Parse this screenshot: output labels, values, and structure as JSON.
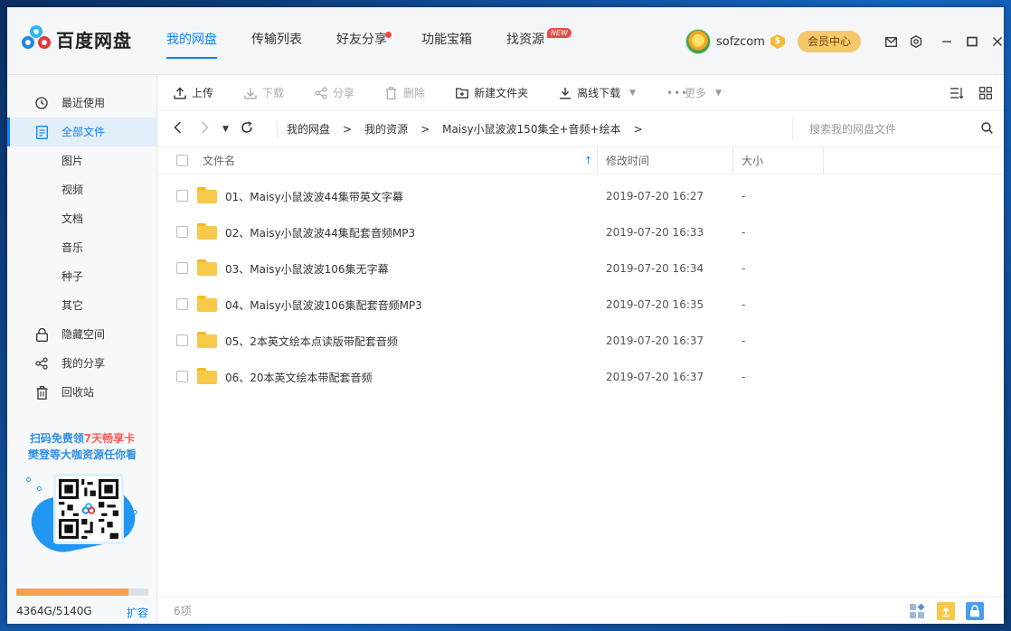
{
  "app": {
    "logo_text": "百度网盘"
  },
  "nav": {
    "tabs": [
      {
        "label": "我的网盘"
      },
      {
        "label": "传输列表"
      },
      {
        "label": "好友分享"
      },
      {
        "label": "功能宝箱"
      },
      {
        "label": "找资源",
        "badge": "NEW"
      }
    ]
  },
  "user": {
    "name": "sofzcom",
    "coin_symbol": "$",
    "member_label": "会员中心"
  },
  "sidebar": {
    "items": [
      {
        "label": "最近使用"
      },
      {
        "label": "全部文件"
      },
      {
        "label": "图片"
      },
      {
        "label": "视频"
      },
      {
        "label": "文档"
      },
      {
        "label": "音乐"
      },
      {
        "label": "种子"
      },
      {
        "label": "其它"
      },
      {
        "label": "隐藏空间"
      },
      {
        "label": "我的分享"
      },
      {
        "label": "回收站"
      }
    ],
    "promo": {
      "line1_a": "扫码免费领",
      "line1_hl": "7天畅享卡",
      "line2": "樊登等大咖资源任你看"
    },
    "storage": {
      "used_text": "4364G/5140G",
      "used_fraction": 0.849,
      "expand_label": "扩容"
    }
  },
  "toolbar": {
    "upload": "上传",
    "download": "下载",
    "share": "分享",
    "delete": "删除",
    "new_folder": "新建文件夹",
    "offline_download": "离线下载",
    "more": "更多"
  },
  "path": {
    "crumbs": [
      "我的网盘",
      "我的资源",
      "Maisy小鼠波波150集全+音频+绘本"
    ],
    "separator": ">",
    "search_placeholder": "搜索我的网盘文件"
  },
  "table": {
    "headers": {
      "name": "文件名",
      "time": "修改时间",
      "size": "大小"
    },
    "rows": [
      {
        "name": "01、Maisy小鼠波波44集带英文字幕",
        "time": "2019-07-20 16:27",
        "size": "-"
      },
      {
        "name": "02、Maisy小鼠波波44集配套音频MP3",
        "time": "2019-07-20 16:33",
        "size": "-"
      },
      {
        "name": "03、Maisy小鼠波波106集无字幕",
        "time": "2019-07-20 16:34",
        "size": "-"
      },
      {
        "name": "04、Maisy小鼠波波106集配套音频MP3",
        "time": "2019-07-20 16:35",
        "size": "-"
      },
      {
        "name": "05、2本英文绘本点读版带配套音频",
        "time": "2019-07-20 16:37",
        "size": "-"
      },
      {
        "name": "06、20本英文绘本带配套音频",
        "time": "2019-07-20 16:37",
        "size": "-"
      }
    ]
  },
  "status": {
    "count": "6项"
  },
  "colors": {
    "accent": "#0a84ff",
    "folder": "#f7c948",
    "member": "#f5c86b",
    "storage_fill": "#f4a052"
  }
}
